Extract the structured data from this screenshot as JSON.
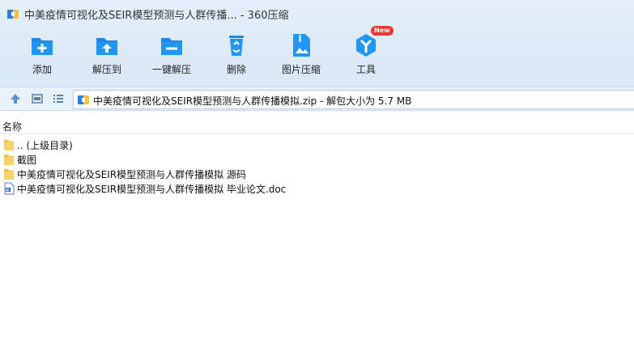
{
  "window": {
    "title": "中美疫情可视化及SEIR模型预测与人群传播... - 360压缩"
  },
  "toolbar": {
    "items": [
      {
        "label": "添加",
        "icon": "add-icon"
      },
      {
        "label": "解压到",
        "icon": "extract-to-icon"
      },
      {
        "label": "一键解压",
        "icon": "one-click-extract-icon"
      },
      {
        "label": "删除",
        "icon": "recycle-bin-icon"
      },
      {
        "label": "图片压缩",
        "icon": "image-compress-icon"
      },
      {
        "label": "工具",
        "icon": "tools-icon",
        "badge": "New"
      }
    ]
  },
  "pathbar": {
    "path": "中美疫情可视化及SEIR模型预测与人群传播模拟.zip - 解包大小为 5.7 MB"
  },
  "list": {
    "column_name": "名称",
    "items": [
      {
        "name": ".. (上级目录)",
        "icon": "folder-icon"
      },
      {
        "name": "截图",
        "icon": "folder-icon"
      },
      {
        "name": "中美疫情可视化及SEIR模型预测与人群传播模拟 源码",
        "icon": "folder-icon"
      },
      {
        "name": "中美疫情可视化及SEIR模型预测与人群传播模拟 毕业论文.doc",
        "icon": "word-document-icon"
      }
    ]
  },
  "colors": {
    "accent": "#1e88e5",
    "folder": "#f5c242",
    "badge": "#e53935"
  }
}
